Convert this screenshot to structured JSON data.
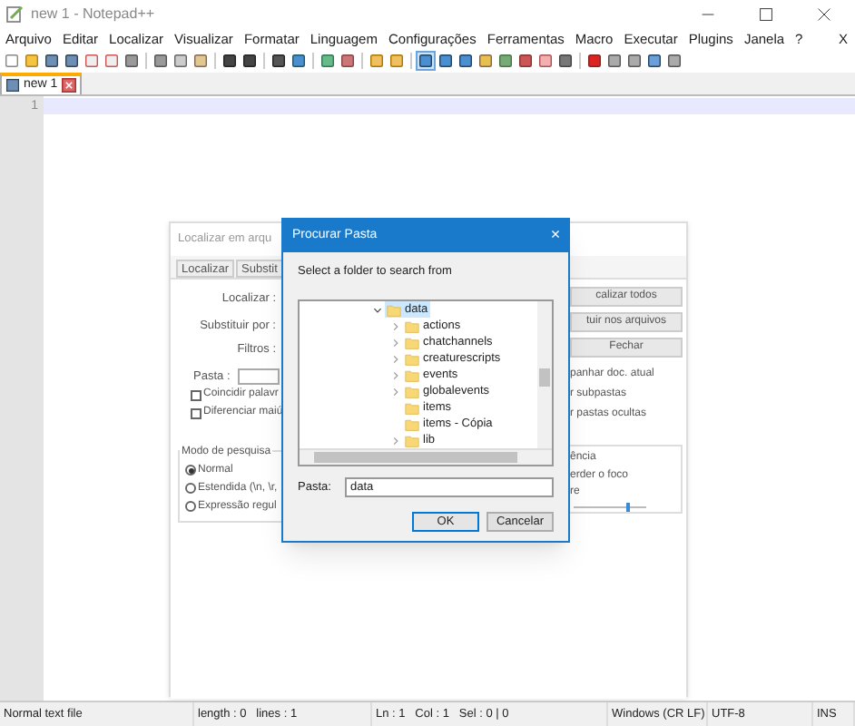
{
  "window": {
    "title": "new 1 - Notepad++"
  },
  "menu": [
    "Arquivo",
    "Editar",
    "Localizar",
    "Visualizar",
    "Formatar",
    "Linguagem",
    "Configurações",
    "Ferramentas",
    "Macro",
    "Executar",
    "Plugins",
    "Janela",
    "?"
  ],
  "menu_close": "X",
  "tabs": [
    {
      "label": "new 1",
      "selected": true
    }
  ],
  "editor": {
    "line_numbers": [
      "1"
    ]
  },
  "find_dialog": {
    "title": "Localizar em arqu",
    "tabs": [
      {
        "label": "Localizar",
        "selected": false
      },
      {
        "label": "Substit",
        "selected": false
      }
    ],
    "fields": [
      {
        "label": "Localizar :"
      },
      {
        "label": "Substituir por :"
      },
      {
        "label": "Filtros :"
      },
      {
        "label": "Pasta :"
      }
    ],
    "options": [
      {
        "label": "Coincidir palavr",
        "checked": false
      },
      {
        "label": "Diferenciar maiú",
        "checked": false
      }
    ],
    "search_mode": {
      "title": "Modo de pesquisa",
      "options": [
        {
          "label": "Normal",
          "selected": true
        },
        {
          "label": "Estendida (\\n, \\r,",
          "selected": false
        },
        {
          "label": "Expressão regul",
          "selected": false
        }
      ]
    },
    "buttons": [
      "calizar todos",
      "tuir nos arquivos",
      "Fechar"
    ],
    "right_options": [
      "panhar doc. atual",
      "r subpastas",
      "r pastas ocultas"
    ],
    "transparency": {
      "labels": [
        "ência",
        "erder o foco",
        "re"
      ],
      "level": 0.75
    }
  },
  "folder_dialog": {
    "title": "Procurar Pasta",
    "close": "×",
    "prompt": "Select a folder to search from",
    "tree": [
      {
        "label": "data",
        "expandable": true,
        "expanded": true,
        "selected": true,
        "children": [
          {
            "label": "actions",
            "expandable": true,
            "selected": false
          },
          {
            "label": "chatchannels",
            "expandable": true,
            "selected": false
          },
          {
            "label": "creaturescripts",
            "expandable": true,
            "selected": false
          },
          {
            "label": "events",
            "expandable": true,
            "selected": false
          },
          {
            "label": "globalevents",
            "expandable": true,
            "selected": false
          },
          {
            "label": "items",
            "expandable": false,
            "selected": false
          },
          {
            "label": "items - Cópia",
            "expandable": false,
            "selected": false
          },
          {
            "label": "lib",
            "expandable": true,
            "selected": false
          }
        ]
      }
    ],
    "folder_label": "Pasta:",
    "folder_value": "data",
    "buttons": [
      "OK",
      "Cancelar"
    ]
  },
  "status_bar": [
    "Normal text file",
    "length : 0   lines : 1",
    "Ln : 1   Col : 1   Sel : 0 | 0",
    "Windows (CR LF)",
    "UTF-8",
    "INS"
  ]
}
